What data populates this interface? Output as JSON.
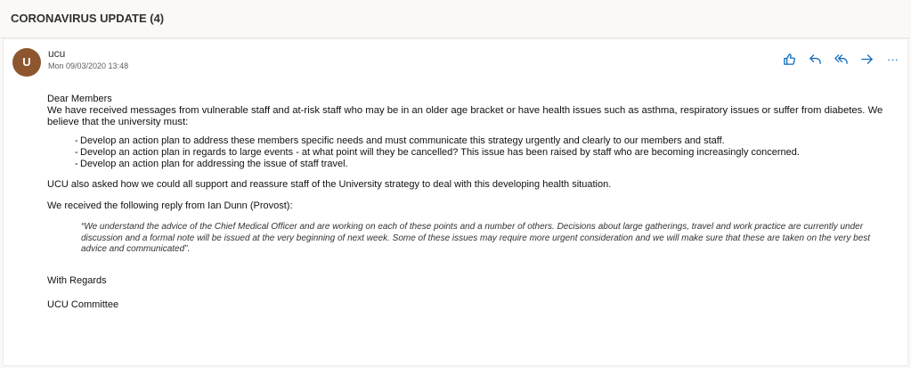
{
  "subject": "CORONAVIRUS UPDATE (4)",
  "message": {
    "avatar_initial": "U",
    "sender": "ucu",
    "date": "Mon 09/03/2020 13:48",
    "actions": [
      {
        "name": "like",
        "icon": "thumbs-up-icon"
      },
      {
        "name": "reply",
        "icon": "reply-icon"
      },
      {
        "name": "reply-all",
        "icon": "reply-all-icon"
      },
      {
        "name": "forward",
        "icon": "forward-icon"
      },
      {
        "name": "more",
        "icon": "more-icon",
        "label": "···"
      }
    ]
  },
  "body": {
    "greeting": "Dear Members",
    "intro": "We have received messages from vulnerable staff and at-risk staff who may be in an older age bracket or have health issues such as asthma, respiratory issues or suffer from diabetes.  We believe that the university must:",
    "items": [
      "Develop an action plan to address these members specific needs and must communicate this strategy urgently and clearly to our members and staff.",
      "Develop an action plan in regards to large events - at what point will they be cancelled?  This issue has been raised by staff who are becoming increasingly concerned.",
      "Develop an action plan for addressing the issue of staff travel."
    ],
    "support": "UCU also asked how we could all support and reassure staff of the University strategy to deal with this developing health situation.",
    "reply_intro": "We received the following reply from Ian Dunn (Provost):",
    "quote": "“We understand the advice of the Chief Medical Officer and are working on each of these points and a number of others. Decisions about large gatherings, travel and work practice are currently under discussion and a formal note will be issued at the very beginning of next week. Some of these issues may require more urgent consideration and we will make sure that these are taken on the very best advice and communicated”.",
    "closing": "With Regards",
    "signature": "UCU Committee"
  },
  "colors": {
    "accent": "#0f6cbd",
    "avatar": "#8e562e"
  }
}
